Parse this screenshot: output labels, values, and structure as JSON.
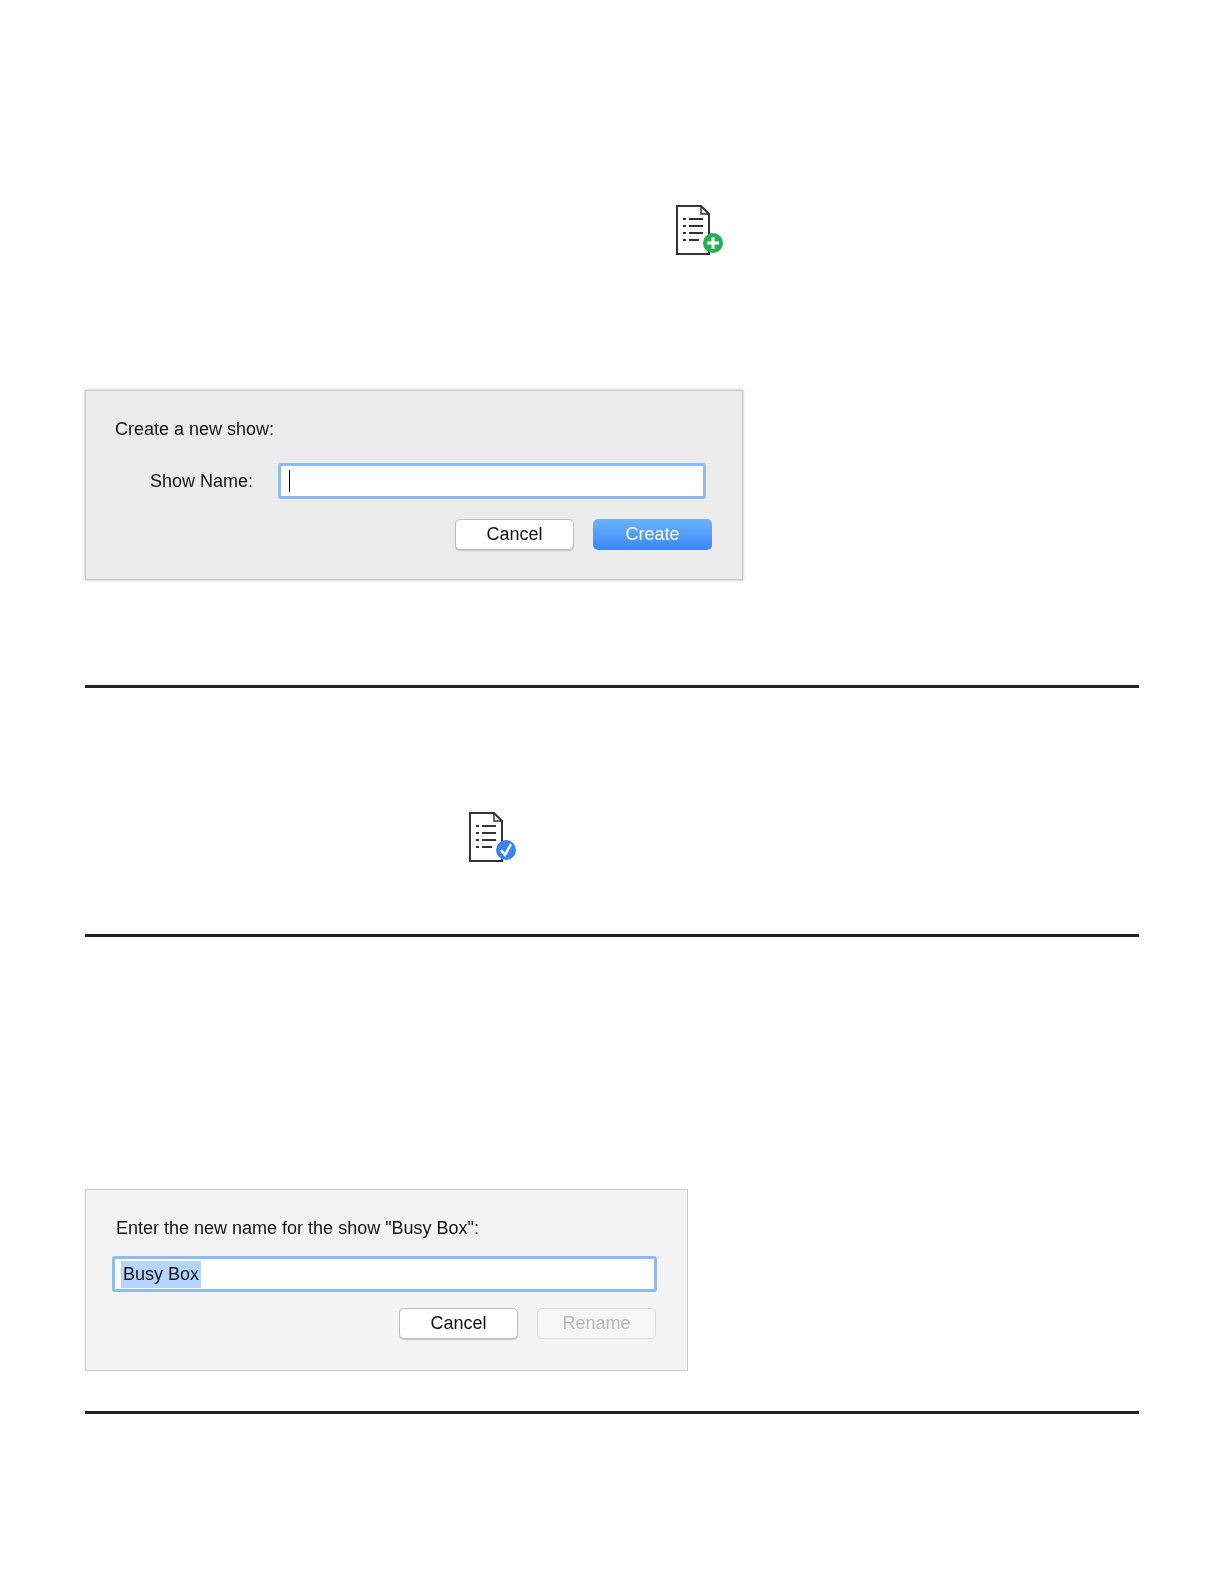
{
  "create_dialog": {
    "prompt": "Create a new show:",
    "field_label": "Show Name:",
    "field_focused": true,
    "buttons": [
      {
        "label": "Cancel",
        "default": false,
        "disabled": false
      },
      {
        "label": "Create",
        "default": true,
        "disabled": false
      }
    ]
  },
  "rename_dialog": {
    "prompt": "Enter the new name for the show \"Busy Box\":",
    "field_value": "Busy Box",
    "field_focused": true,
    "text_selected": true,
    "buttons": [
      {
        "label": "Cancel",
        "default": false,
        "disabled": false
      },
      {
        "label": "Rename",
        "default": false,
        "disabled": true
      }
    ]
  }
}
